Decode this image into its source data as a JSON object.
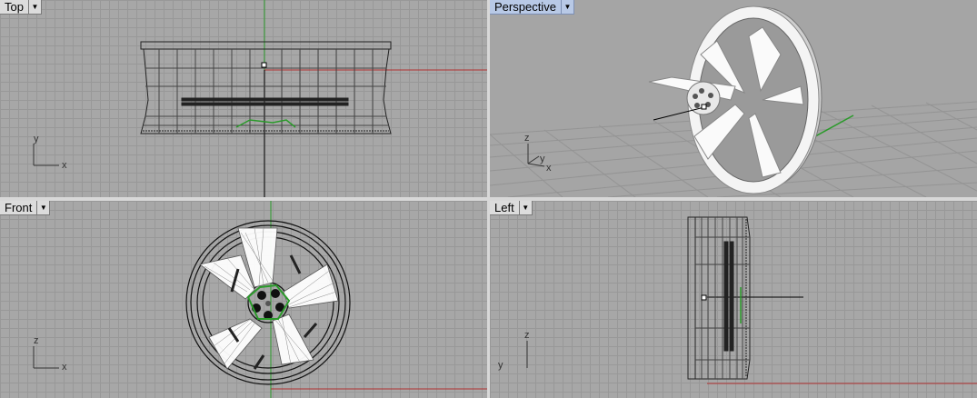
{
  "viewports": {
    "top": {
      "label": "Top",
      "axis_h": "x",
      "axis_v": "y"
    },
    "perspective": {
      "label": "Perspective",
      "axis_h": "x",
      "axis_v": "z",
      "axis_d": "y"
    },
    "front": {
      "label": "Front",
      "axis_h": "x",
      "axis_v": "z"
    },
    "left": {
      "label": "Left",
      "axis_h": "y",
      "axis_v": "z"
    }
  },
  "icons": {
    "dropdown": "chevron-down-icon"
  },
  "colors": {
    "x_axis": "#b03030",
    "y_axis": "#2a9a2a",
    "grid": "#989898",
    "background": "#a7a7a7",
    "active_label": "#b8c9e6"
  }
}
